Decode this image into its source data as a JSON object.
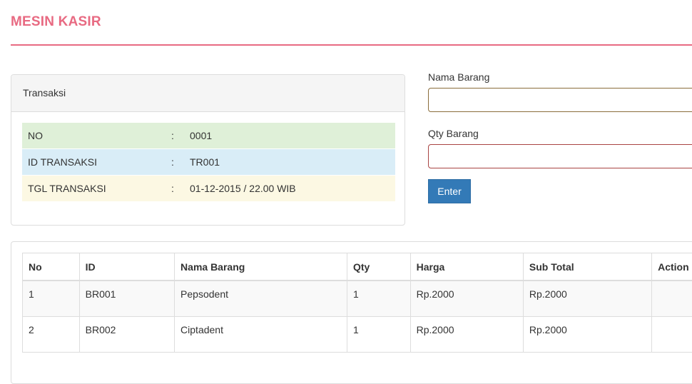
{
  "header": {
    "title": "MESIN KASIR"
  },
  "transaksi": {
    "heading": "Transaksi",
    "rows": [
      {
        "label": "NO",
        "sep": ":",
        "value": "0001"
      },
      {
        "label": "ID TRANSAKSI",
        "sep": ":",
        "value": "TR001"
      },
      {
        "label": "TGL TRANSAKSI",
        "sep": ":",
        "value": "01-12-2015 / 22.00 WIB"
      }
    ]
  },
  "form": {
    "nama_label": "Nama Barang",
    "nama_value": "",
    "qty_label": "Qty Barang",
    "qty_value": "",
    "enter_label": "Enter"
  },
  "items": {
    "columns": [
      "No",
      "ID",
      "Nama Barang",
      "Qty",
      "Harga",
      "Sub Total",
      "Action"
    ],
    "rows": [
      {
        "no": "1",
        "id": "BR001",
        "nama": "Pepsodent",
        "qty": "1",
        "harga": "Rp.2000",
        "subtotal": "Rp.2000",
        "action": ""
      },
      {
        "no": "2",
        "id": "BR002",
        "nama": "Ciptadent",
        "qty": "1",
        "harga": "Rp.2000",
        "subtotal": "Rp.2000",
        "action": ""
      }
    ]
  },
  "colors": {
    "title": "#e86a82",
    "primary_button": "#337ab7",
    "row_success": "#dff0d8",
    "row_info": "#d9edf7",
    "row_warning": "#fcf8e3"
  }
}
